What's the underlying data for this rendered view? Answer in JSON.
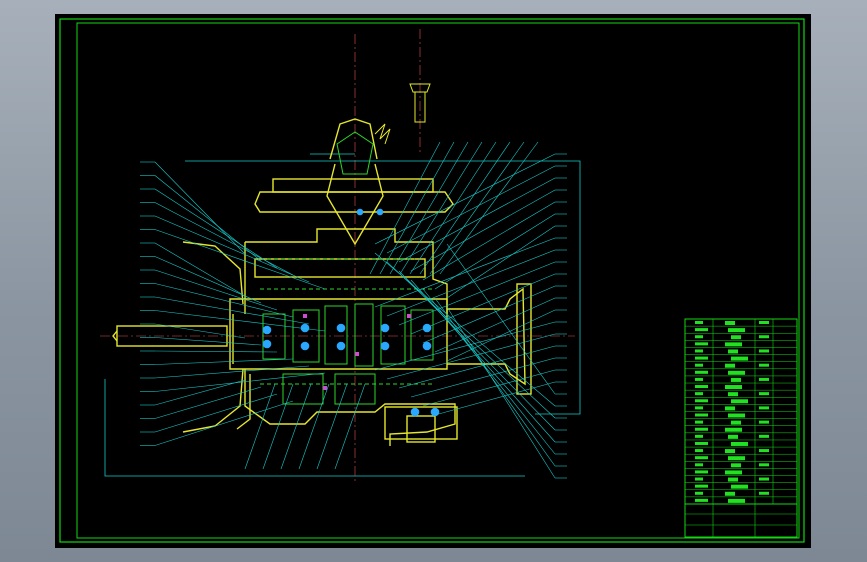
{
  "viewer": {
    "background": "#8f9aa6",
    "canvas_background": "#000000"
  },
  "drawing": {
    "colors": {
      "frame": "#12d812",
      "section": "#e6e62e",
      "gear_fill": "#2bd629",
      "leader": "#17c9c9",
      "bearing": "#2aa8ff",
      "detail": "#d04bd0",
      "table_text": "#22e022"
    },
    "title_block_rows": 26,
    "balloon_count_left": 22,
    "balloon_count_right": 28
  }
}
